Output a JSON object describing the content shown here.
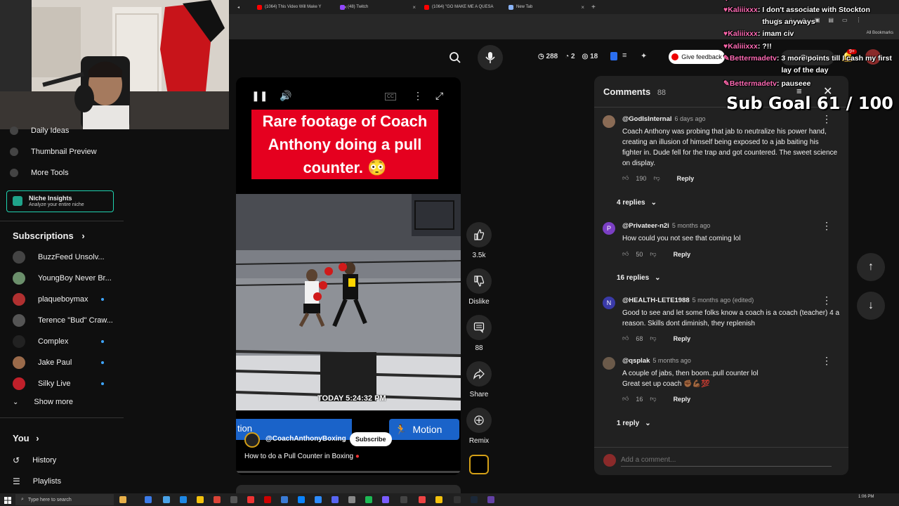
{
  "browser": {
    "tabs": [
      {
        "title": "(1064) This Video Will Make Y",
        "color": "#ff0000"
      },
      {
        "title": "(48) Twitch",
        "color": "#9146ff"
      },
      {
        "title": "(1064) \"GO MAKE ME A QUESA",
        "color": "#ff0000"
      },
      {
        "title": "New Tab",
        "color": "#8ab4f8"
      }
    ],
    "new_tab_label": "+",
    "all_bookmarks": "All Bookmarks"
  },
  "header": {
    "stats": {
      "views": "288",
      "likes": "2",
      "eye": "18"
    },
    "feedback_label": "Give feedback",
    "create_label": "Create",
    "notif_badge": "9+"
  },
  "sidebar": {
    "tools": [
      {
        "label": "Daily Ideas",
        "icon": "lightbulb-icon"
      },
      {
        "label": "Thumbnail Preview",
        "icon": "image-icon"
      },
      {
        "label": "More Tools",
        "icon": "tools-icon"
      }
    ],
    "niche": {
      "title": "Niche Insights",
      "subtitle": "Analyze your entire niche"
    },
    "subscriptions_title": "Subscriptions",
    "subscriptions": [
      {
        "name": "BuzzFeed Unsolv...",
        "color": "#444",
        "dot": false
      },
      {
        "name": "YoungBoy Never Br...",
        "color": "#6b8f6b",
        "dot": false
      },
      {
        "name": "plaqueboymax",
        "color": "#b03030",
        "dot": true
      },
      {
        "name": "Terence \"Bud\" Craw...",
        "color": "#555",
        "dot": false
      },
      {
        "name": "Complex",
        "color": "#222",
        "dot": true
      },
      {
        "name": "Jake Paul",
        "color": "#9a6a4a",
        "dot": true
      },
      {
        "name": "Silky Live",
        "color": "#c0202a",
        "dot": true
      }
    ],
    "show_more": "Show more",
    "you_title": "You",
    "you_items": [
      {
        "label": "History",
        "icon": "history-icon"
      },
      {
        "label": "Playlists",
        "icon": "playlists-icon"
      }
    ]
  },
  "video": {
    "caption": "Rare footage of Coach Anthony doing a pull counter.",
    "caption_emoji": "😳",
    "timestamp": "TODAY 5:24:32 PM",
    "channel": "@CoachAnthonyBoxing",
    "subscribe_label": "Subscribe",
    "motion_label": "Motion",
    "motion_left": "tion",
    "title": "How to do a Pull Counter in Boxing",
    "cc_label": "CC"
  },
  "actions": {
    "likes": "3.5k",
    "dislike": "Dislike",
    "comments": "88",
    "share": "Share",
    "remix": "Remix"
  },
  "comments": {
    "title": "Comments",
    "count": "88",
    "add_placeholder": "Add a comment...",
    "items": [
      {
        "author": "@GodIsInternal",
        "time": "6 days ago",
        "text": "Coach Anthony was probing that jab to neutralize his power hand, creating an illusion of himself being exposed to a jab baiting his fighter in. Dude fell for the trap and got countered. The sweet science on display.",
        "likes": "190",
        "reply": "Reply",
        "replies": "4 replies",
        "av_color": "#8a6b55",
        "av_letter": ""
      },
      {
        "author": "@Privateer-n2i",
        "time": "5 months ago",
        "text": "How could you not see that coming lol",
        "likes": "50",
        "reply": "Reply",
        "replies": "16 replies",
        "av_color": "#7b3fc4",
        "av_letter": "P"
      },
      {
        "author": "@HEALTH-LETE1988",
        "time": "5 months ago (edited)",
        "text": "Good to see and let some folks know a coach is a coach (teacher) 4 a reason.  Skills dont diminish, they replenish",
        "likes": "68",
        "reply": "Reply",
        "replies": "",
        "av_color": "#3a3aa8",
        "av_letter": "N"
      },
      {
        "author": "@qsplak",
        "time": "5 months ago",
        "text": "A couple of jabs, then boom..pull counter lol",
        "text2": "Great set up coach ✊🏾💪🏾💯",
        "likes": "16",
        "reply": "Reply",
        "replies": "1 reply",
        "av_color": "#6b5a4a",
        "av_letter": ""
      }
    ]
  },
  "chat": [
    {
      "name": "Kaliiixxx",
      "msg": "I don't associate with Stockton thugs anyways"
    },
    {
      "name": "Kaliiixxx",
      "msg": "imam civ"
    },
    {
      "name": "Kaliiixxx",
      "msg": "?!!"
    },
    {
      "name": "Bettermadetv",
      "msg": "3 more points till I cash my first lay of the day"
    },
    {
      "name": "Bettermadetv",
      "msg": "pauseee"
    }
  ],
  "subgoal": "Sub Goal  61 / 100",
  "taskbar": {
    "search_placeholder": "Type here to search",
    "time": "1:06 PM"
  }
}
